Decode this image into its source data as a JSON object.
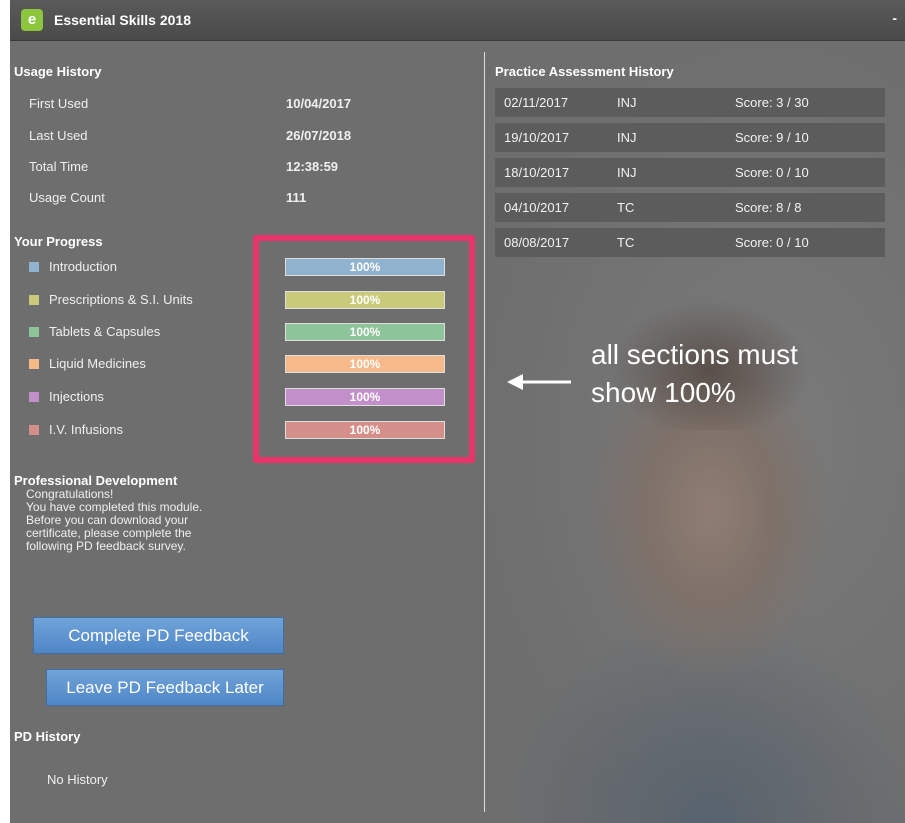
{
  "window": {
    "title": "Essential Skills 2018",
    "logo_letter": "e",
    "minimize_label": "-"
  },
  "usage_history": {
    "title": "Usage History",
    "rows": [
      {
        "label": "First Used",
        "value": "10/04/2017"
      },
      {
        "label": "Last Used",
        "value": "26/07/2018"
      },
      {
        "label": "Total Time",
        "value": "12:38:59"
      },
      {
        "label": "Usage Count",
        "value": "111"
      }
    ]
  },
  "progress": {
    "title": "Your Progress",
    "items": [
      {
        "label": "Introduction",
        "percent_label": "100%",
        "percent": 100,
        "color": "#8fb3cf"
      },
      {
        "label": "Prescriptions & S.I. Units",
        "percent_label": "100%",
        "percent": 100,
        "color": "#c9ca7a"
      },
      {
        "label": "Tablets & Capsules",
        "percent_label": "100%",
        "percent": 100,
        "color": "#8ec49a"
      },
      {
        "label": "Liquid Medicines",
        "percent_label": "100%",
        "percent": 100,
        "color": "#f5b98a"
      },
      {
        "label": "Injections",
        "percent_label": "100%",
        "percent": 100,
        "color": "#c38fcb"
      },
      {
        "label": "I.V. Infusions",
        "percent_label": "100%",
        "percent": 100,
        "color": "#d58f8a"
      }
    ]
  },
  "professional_development": {
    "title": "Professional Development",
    "lines": [
      "Congratulations!",
      "You have completed this module.",
      "Before you can download your",
      "certificate, please complete the",
      "following PD feedback survey."
    ],
    "complete_button": "Complete PD Feedback",
    "later_button": "Leave PD Feedback Later"
  },
  "pd_history": {
    "title": "PD History",
    "empty_text": "No History"
  },
  "assessment_history": {
    "title": "Practice Assessment History",
    "rows": [
      {
        "date": "02/11/2017",
        "type": "INJ",
        "score": "Score: 3 / 30"
      },
      {
        "date": "19/10/2017",
        "type": "INJ",
        "score": "Score: 9 / 10"
      },
      {
        "date": "18/10/2017",
        "type": "INJ",
        "score": "Score: 0 / 10"
      },
      {
        "date": "04/10/2017",
        "type": "TC",
        "score": "Score: 8 / 8"
      },
      {
        "date": "08/08/2017",
        "type": "TC",
        "score": "Score: 0 / 10"
      }
    ]
  },
  "annotation": {
    "lines": [
      "all sections must",
      "show 100%"
    ],
    "highlight_color": "#e8336b"
  }
}
